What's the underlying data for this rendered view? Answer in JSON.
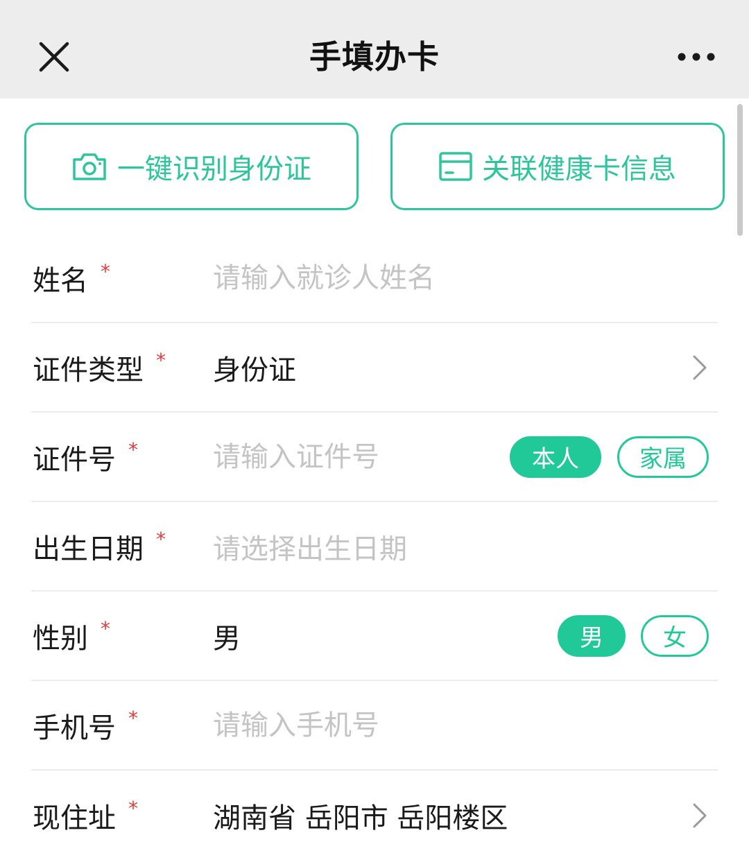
{
  "header": {
    "title": "手填办卡"
  },
  "quick_actions": {
    "scan_id_label": "一键识别身份证",
    "link_health_card_label": "关联健康卡信息"
  },
  "form": {
    "name": {
      "label": "姓名",
      "required_mark": "*",
      "placeholder": "请输入就诊人姓名",
      "value": ""
    },
    "id_type": {
      "label": "证件类型",
      "required_mark": "*",
      "value": "身份证"
    },
    "id_number": {
      "label": "证件号",
      "required_mark": "*",
      "placeholder": "请输入证件号",
      "value": "",
      "options": [
        "本人",
        "家属"
      ],
      "selected": "本人"
    },
    "birth_date": {
      "label": "出生日期",
      "required_mark": "*",
      "placeholder": "请选择出生日期"
    },
    "gender": {
      "label": "性别",
      "required_mark": "*",
      "value": "男",
      "options": [
        "男",
        "女"
      ],
      "selected": "男"
    },
    "phone": {
      "label": "手机号",
      "required_mark": "*",
      "placeholder": "请输入手机号",
      "value": ""
    },
    "address": {
      "label": "现住址",
      "required_mark": "*",
      "value": "湖南省 岳阳市 岳阳楼区"
    }
  },
  "colors": {
    "accent": "#20c997",
    "required": "#e23c3c",
    "header_bg": "#ededed",
    "placeholder": "#c4c4c4"
  },
  "icons": {
    "close": "close-icon",
    "more": "more-dots-icon",
    "camera": "camera-icon",
    "card": "card-icon",
    "chevron": "chevron-right-icon"
  }
}
